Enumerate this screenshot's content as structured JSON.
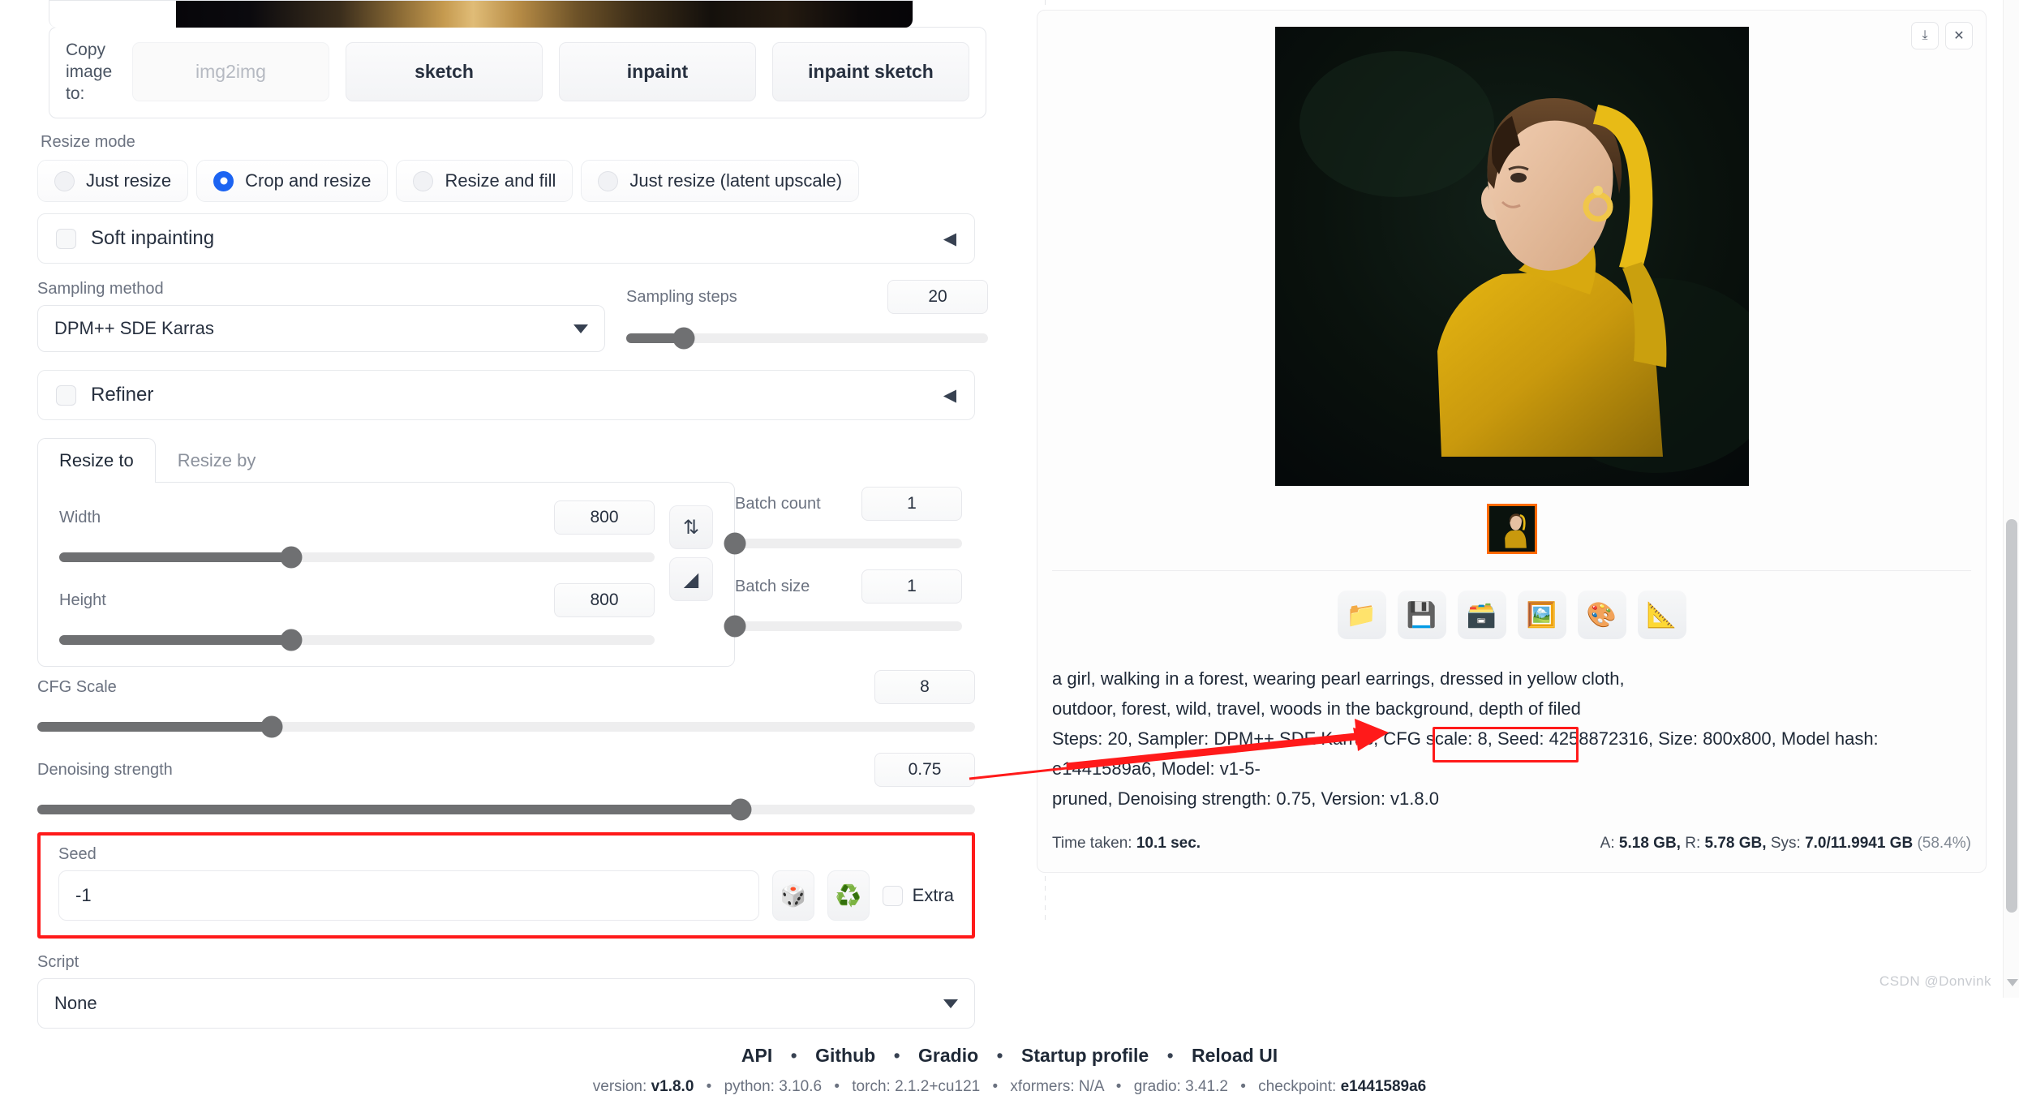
{
  "left": {
    "copy_image": {
      "label": "Copy image to:",
      "buttons": [
        {
          "label": "img2img",
          "disabled": true
        },
        {
          "label": "sketch",
          "disabled": false
        },
        {
          "label": "inpaint",
          "disabled": false
        },
        {
          "label": "inpaint sketch",
          "disabled": false
        }
      ]
    },
    "resize_mode": {
      "label": "Resize mode",
      "options": [
        {
          "label": "Just resize",
          "selected": false
        },
        {
          "label": "Crop and resize",
          "selected": true
        },
        {
          "label": "Resize and fill",
          "selected": false
        },
        {
          "label": "Just resize (latent upscale)",
          "selected": false
        }
      ]
    },
    "soft_inpainting": {
      "label": "Soft inpainting",
      "checked": false,
      "arrow": "◀"
    },
    "refiner": {
      "label": "Refiner",
      "checked": false,
      "arrow": "◀"
    },
    "sampling_method": {
      "label": "Sampling method",
      "value": "DPM++ SDE Karras"
    },
    "sampling_steps": {
      "label": "Sampling steps",
      "value": "20",
      "percent": 16
    },
    "resize_tabs": [
      {
        "label": "Resize to",
        "active": true
      },
      {
        "label": "Resize by",
        "active": false
      }
    ],
    "width": {
      "label": "Width",
      "value": "800",
      "percent": 39
    },
    "height": {
      "label": "Height",
      "value": "800",
      "percent": 39
    },
    "swap_button": {
      "icon": "⇅",
      "name": "swap-dimensions"
    },
    "ruler_button": {
      "icon": "◢",
      "name": "detect-size"
    },
    "batch_count": {
      "label": "Batch count",
      "value": "1",
      "percent": 0
    },
    "batch_size": {
      "label": "Batch size",
      "value": "1",
      "percent": 0
    },
    "cfg_scale": {
      "label": "CFG Scale",
      "value": "8",
      "percent": 25
    },
    "denoising_strength": {
      "label": "Denoising strength",
      "value": "0.75",
      "percent": 75
    },
    "seed": {
      "label": "Seed",
      "value": "-1",
      "dice_icon": "🎲",
      "recycle_icon": "♻️",
      "extra_label": "Extra",
      "extra_checked": false
    },
    "script": {
      "label": "Script",
      "value": "None"
    }
  },
  "right": {
    "toolbar": [
      {
        "name": "download-icon",
        "glyph": "⤓"
      },
      {
        "name": "close-icon",
        "glyph": "✕"
      }
    ],
    "gallery_tools": [
      {
        "name": "open-folder-icon",
        "glyph": "📁"
      },
      {
        "name": "save-icon",
        "glyph": "💾"
      },
      {
        "name": "save-zip-icon",
        "glyph": "🗃️"
      },
      {
        "name": "send-to-img2img-icon",
        "glyph": "🖼️"
      },
      {
        "name": "send-to-inpaint-icon",
        "glyph": "🎨"
      },
      {
        "name": "send-to-extras-icon",
        "glyph": "📐"
      }
    ],
    "info": {
      "prompt_line1": "a girl, walking in a forest, wearing pearl earrings, dressed in yellow cloth,",
      "prompt_line2": "outdoor, forest, wild, travel, woods in the background, depth of filed",
      "params_line1": "Steps: 20, Sampler: DPM++ SDE Karras, CFG scale: 8, Seed: 4258872316, Size: 800x800, Model hash: e1441589a6, Model: v1-5-",
      "params_line2": "pruned, Denoising strength: 0.75, Version: v1.8.0"
    },
    "time_taken_label": "Time taken:",
    "time_taken_value": "10.1 sec.",
    "memory": {
      "a_label": "A:",
      "a_value": "5.18 GB,",
      "r_label": "R:",
      "r_value": "5.78 GB,",
      "sys_label": "Sys:",
      "sys_value": "7.0/11.9941 GB",
      "sys_pct": "(58.4%)"
    }
  },
  "footer": {
    "links": [
      "API",
      "Github",
      "Gradio",
      "Startup profile",
      "Reload UI"
    ],
    "separator": "•",
    "meta": [
      {
        "key": "version:",
        "val": "v1.8.0"
      },
      {
        "key": "python:",
        "val": "3.10.6"
      },
      {
        "key": "torch:",
        "val": "2.1.2+cu121"
      },
      {
        "key": "xformers:",
        "val": "N/A"
      },
      {
        "key": "gradio:",
        "val": "3.41.2"
      },
      {
        "key": "checkpoint:",
        "val": "e1441589a6"
      }
    ]
  },
  "watermark": "CSDN @Donvink"
}
